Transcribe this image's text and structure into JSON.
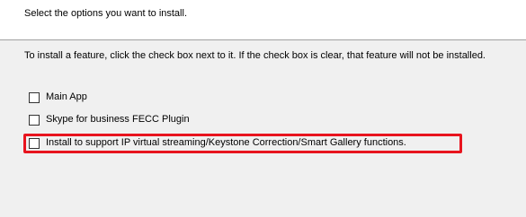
{
  "header": {
    "title": "Select the options you want to install."
  },
  "instructions": {
    "text": "To install a feature, click the check box next to it.  If the check box is clear, that feature will not be installed."
  },
  "options": [
    {
      "label": "Main App",
      "checked": false
    },
    {
      "label": "Skype for business FECC Plugin",
      "checked": false
    },
    {
      "label": "Install to support IP virtual streaming/Keystone Correction/Smart Gallery functions.",
      "checked": false,
      "highlighted": true
    }
  ],
  "colors": {
    "highlight": "#e8141e",
    "background": "#f0f0f0",
    "header_background": "#ffffff"
  }
}
